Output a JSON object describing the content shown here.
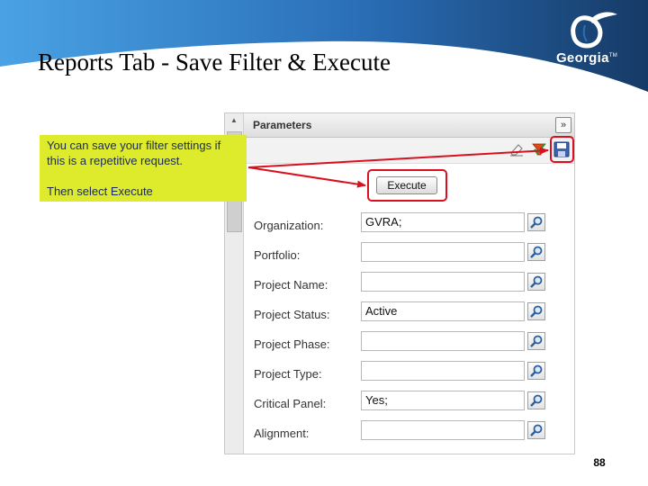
{
  "slide": {
    "title": "Reports Tab - Save Filter & Execute",
    "page_number": "88",
    "logo_text": "Georgia"
  },
  "callout": {
    "line1": "You can save your filter settings if this is a repetitive request.",
    "line2": "Then select Execute"
  },
  "panel": {
    "title": "Parameters",
    "execute_label": "Execute",
    "fields": [
      {
        "label": "Organization:",
        "value": "GVRA;"
      },
      {
        "label": "Portfolio:",
        "value": ""
      },
      {
        "label": "Project Name:",
        "value": ""
      },
      {
        "label": "Project Status:",
        "value": "Active"
      },
      {
        "label": "Project Phase:",
        "value": ""
      },
      {
        "label": "Project Type:",
        "value": ""
      },
      {
        "label": "Critical Panel:",
        "value": "Yes;"
      },
      {
        "label": "Alignment:",
        "value": ""
      }
    ]
  },
  "icons": {
    "collapse": "double-chevron-right-icon",
    "clear": "eraser-icon",
    "apply": "filter-check-icon",
    "save": "floppy-disk-icon",
    "lookup": "magnifier-icon",
    "scroll": "scroll-up-arrow-icon",
    "logo": "georgia-peach-logo-icon"
  },
  "colors": {
    "banner_light": "#3a8fd6",
    "banner_dark": "#163a66",
    "callout": "#ddeb2c",
    "highlight": "#d91020"
  }
}
